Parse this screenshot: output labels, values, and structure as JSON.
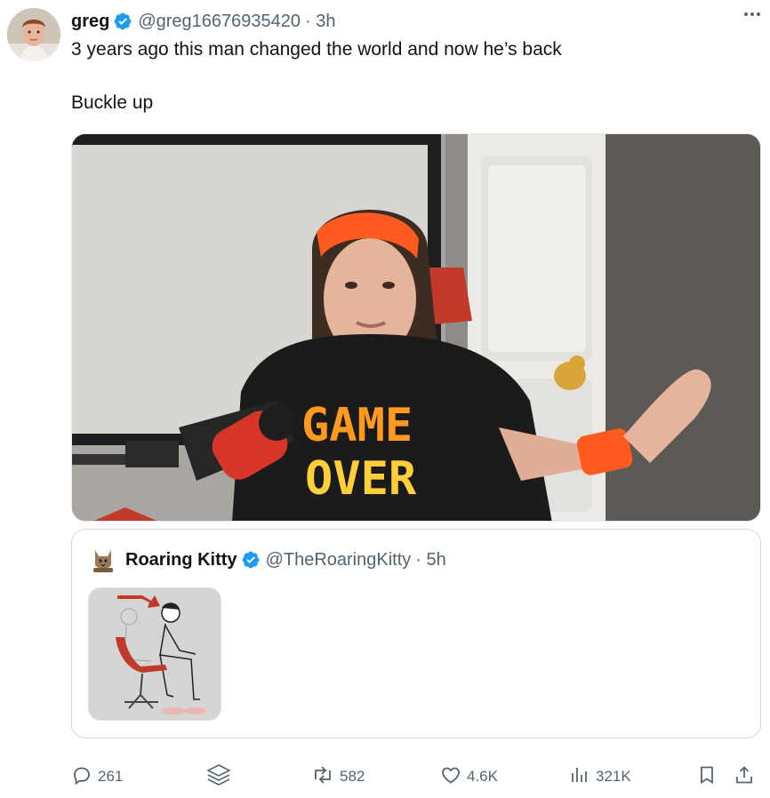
{
  "author": {
    "display_name": "greg",
    "handle": "@greg16676935420",
    "time": "· 3h"
  },
  "tweet": {
    "line1": "3 years ago this man changed the world and now he’s back",
    "line2": "Buckle up"
  },
  "media": {
    "shirt_line1": "GAME",
    "shirt_line2": "OVER"
  },
  "quoted": {
    "display_name": "Roaring Kitty",
    "handle": "@TheRoaringKitty",
    "time": "· 5h"
  },
  "actions": {
    "replies": "261",
    "reposts": "582",
    "likes": "4.6K",
    "views": "321K"
  },
  "colors": {
    "verified": "#1d9bf0",
    "muted": "#536471",
    "text": "#0f1419",
    "headband": "#ff5a1f"
  },
  "icons": [
    "verified-badge-icon",
    "more-icon",
    "reply-icon",
    "grok-icon",
    "repost-icon",
    "like-icon",
    "views-icon",
    "bookmark-icon",
    "share-icon"
  ]
}
